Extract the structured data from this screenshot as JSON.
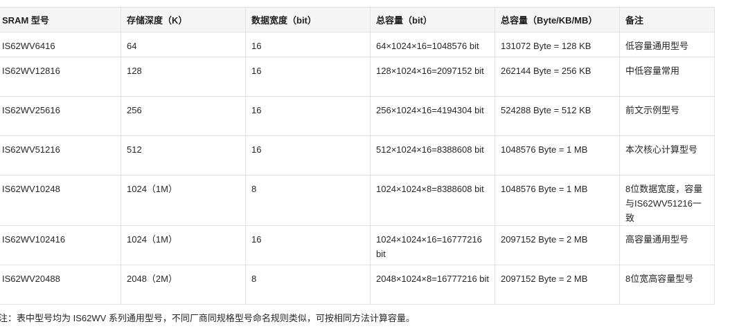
{
  "table": {
    "headers": [
      "SRAM 型号",
      "存储深度（K）",
      "数据宽度（bit）",
      "总容量（bit）",
      "总容量（Byte/KB/MB）",
      "备注"
    ],
    "rows": [
      [
        "IS62WV6416",
        "64",
        "16",
        "64×1024×16=1048576 bit",
        "131072 Byte = 128 KB",
        "低容量通用型号"
      ],
      [
        "IS62WV12816",
        "128",
        "16",
        "128×1024×16=2097152 bit",
        "262144 Byte = 256 KB",
        "中低容量常用"
      ],
      [
        "IS62WV25616",
        "256",
        "16",
        "256×1024×16=4194304 bit",
        "524288 Byte = 512 KB",
        "前文示例型号"
      ],
      [
        "IS62WV51216",
        "512",
        "16",
        "512×1024×16=8388608 bit",
        "1048576 Byte = 1 MB",
        "本次核心计算型号"
      ],
      [
        "IS62WV10248",
        "1024（1M）",
        "8",
        "1024×1024×8=8388608 bit",
        "1048576 Byte = 1 MB",
        "8位数据宽度，容量与IS62WV51216一致"
      ],
      [
        "IS62WV102416",
        "1024（1M）",
        "16",
        "1024×1024×16=16777216 bit",
        "2097152 Byte = 2 MB",
        "高容量通用型号"
      ],
      [
        "IS62WV20488",
        "2048（2M）",
        "8",
        "2048×1024×8=16777216 bit",
        "2097152 Byte = 2 MB",
        "8位宽高容量型号"
      ]
    ]
  },
  "note": "注：表中型号均为 IS62WV 系列通用型号，不同厂商同规格型号命名规则类似，可按相同方法计算容量。"
}
